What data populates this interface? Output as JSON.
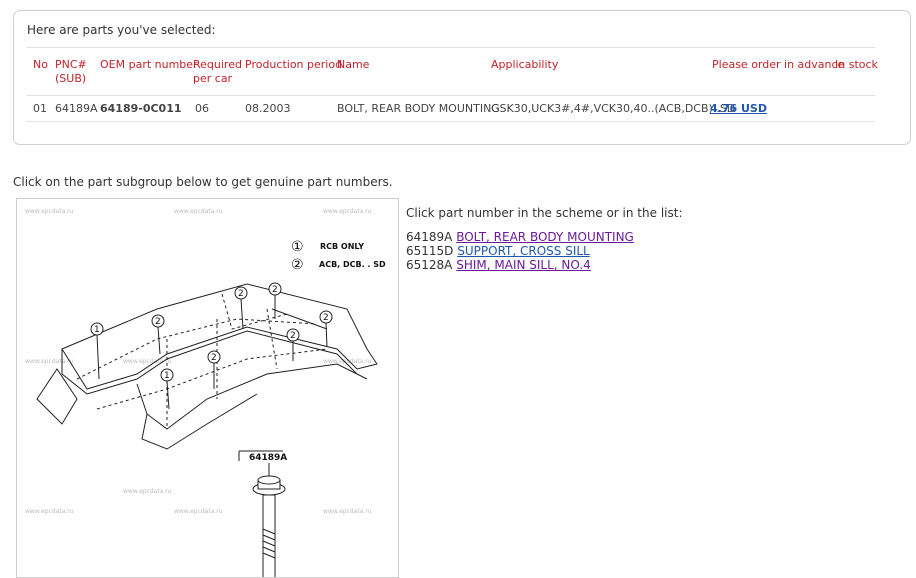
{
  "selected_panel": {
    "title": "Here are parts you've selected:",
    "headers": {
      "no": "No",
      "pnc": "PNC#",
      "pnc_sub": "(SUB)",
      "oem": "OEM part number",
      "required": "Required",
      "required_sub": "per car",
      "production": "Production period",
      "name": "Name",
      "applicability": "Applicability",
      "order": "Please order in advance",
      "stock": "In stock"
    },
    "row": {
      "no": "01",
      "pnc": "64189A",
      "oem": "64189-0C011",
      "required": "06",
      "production": "08.2003",
      "name": "BOLT, REAR BODY MOUNTING",
      "applicability": "GSK30,UCK3#,4#,VCK30,40..(ACB,DCB)..SD",
      "price": "4.76 USD"
    }
  },
  "instruction": "Click on the part subgroup below to get genuine part numbers.",
  "scheme": {
    "legend": [
      {
        "num": "①",
        "text": "RCB  ONLY"
      },
      {
        "num": "②",
        "text": "ACB, DCB. . SD"
      }
    ],
    "callout_label": "64189A",
    "watermark": "www.epcdata.ru"
  },
  "parts_list": {
    "intro": "Click part number in the scheme or in the list:",
    "items": [
      {
        "code": "64189A",
        "label": "BOLT, REAR BODY MOUNTING"
      },
      {
        "code": "65115D",
        "label": "SUPPORT, CROSS SILL"
      },
      {
        "code": "65128A",
        "label": "SHIM, MAIN SILL, NO.4"
      }
    ]
  }
}
